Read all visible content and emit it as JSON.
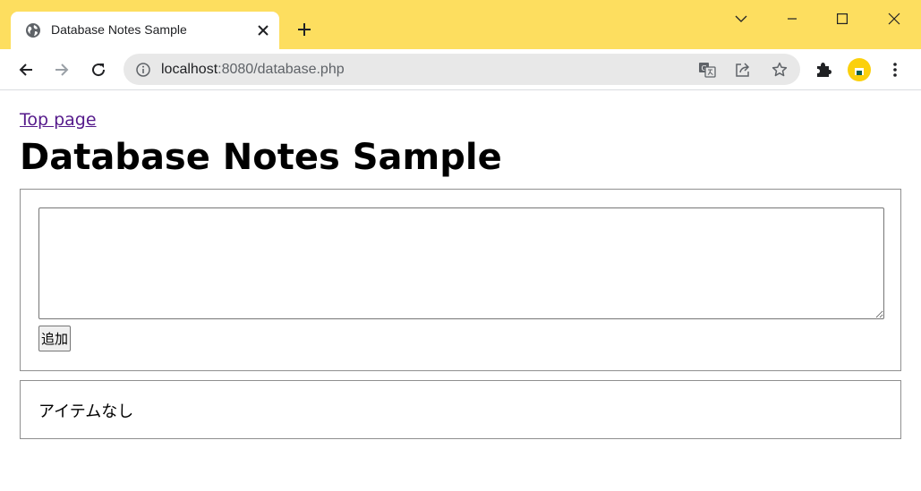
{
  "browser": {
    "tab_title": "Database Notes Sample",
    "url_host": "localhost",
    "url_rest": ":8080/database.php"
  },
  "page": {
    "top_link": "Top page",
    "title": "Database Notes Sample",
    "add_button": "追加",
    "empty_text": "アイテムなし"
  },
  "icons": {
    "favicon": "globe-icon",
    "tab_close": "close-icon",
    "new_tab": "plus-icon",
    "tab_search": "chevron-down-icon",
    "minimize": "minimize-icon",
    "maximize": "maximize-icon",
    "close_window": "close-window-icon",
    "back": "back-arrow-icon",
    "forward": "forward-arrow-icon",
    "reload": "reload-icon",
    "site_info": "info-icon",
    "translate": "translate-icon",
    "share": "share-icon",
    "bookmark": "star-icon",
    "extensions": "puzzle-icon",
    "profile": "avatar",
    "menu": "kebab-menu-icon"
  },
  "colors": {
    "titlebar": "#fdde5f",
    "link_visited": "#551a8b",
    "avatar": "#fbd00c"
  }
}
